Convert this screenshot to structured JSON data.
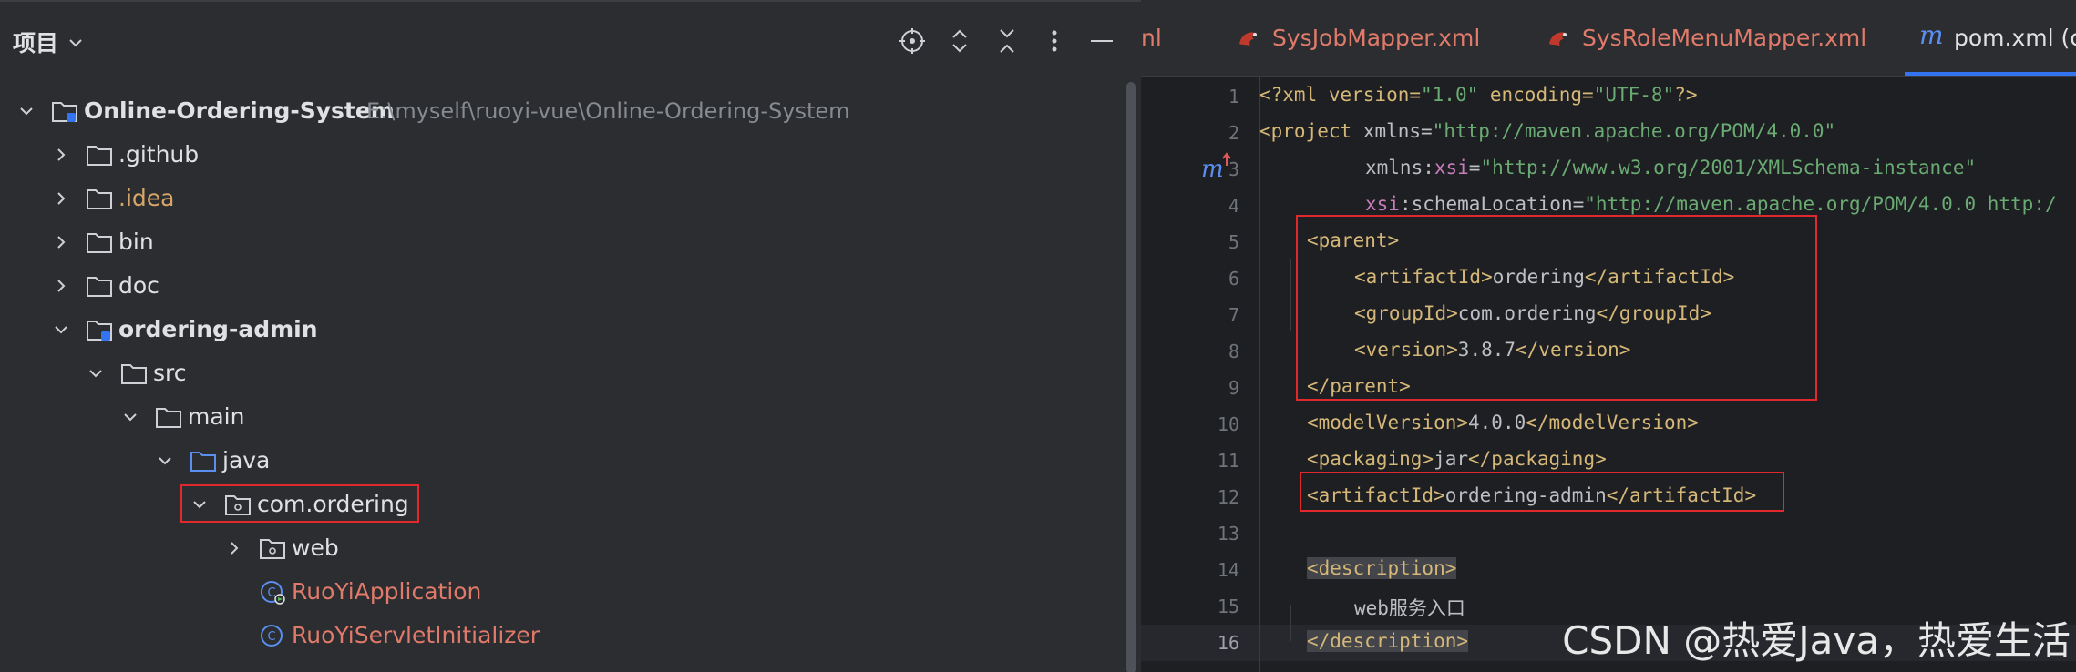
{
  "project_panel": {
    "title": "项目",
    "header_icons": [
      "locate-icon",
      "expand-all-icon",
      "collapse-all-icon",
      "more-icon",
      "minimize-icon"
    ],
    "tree": [
      {
        "label": "Online-Ordering-System",
        "path": "E:\\myself\\ruoyi-vue\\Online-Ordering-System"
      },
      {
        "label": ".github"
      },
      {
        "label": ".idea"
      },
      {
        "label": "bin"
      },
      {
        "label": "doc"
      },
      {
        "label": "ordering-admin"
      },
      {
        "label": "src"
      },
      {
        "label": "main"
      },
      {
        "label": "java"
      },
      {
        "label": "com.ordering"
      },
      {
        "label": "web"
      },
      {
        "label": "RuoYiApplication"
      },
      {
        "label": "RuoYiServletInitializer"
      }
    ]
  },
  "editor": {
    "tabs": [
      {
        "label": "nl"
      },
      {
        "label": "SysJobMapper.xml"
      },
      {
        "label": "SysRoleMenuMapper.xml"
      },
      {
        "label": "pom.xml (c"
      }
    ],
    "line_numbers": [
      "1",
      "2",
      "3",
      "4",
      "5",
      "6",
      "7",
      "8",
      "9",
      "10",
      "11",
      "12",
      "13",
      "14",
      "15",
      "16"
    ],
    "current_line": "16",
    "code": {
      "l1_a": "<?xml version=",
      "l1_b": "\"1.0\"",
      "l1_c": " encoding=",
      "l1_d": "\"UTF-8\"",
      "l1_e": "?>",
      "l2_a": "<project",
      "l2_b": " xmlns=",
      "l2_c": "\"http://maven.apache.org/POM/4.0.0\"",
      "l3_a": "xmlns:",
      "l3_b": "xsi",
      "l3_c": "=",
      "l3_d": "\"http://www.w3.org/2001/XMLSchema-instance\"",
      "l4_a": "xsi",
      "l4_b": ":schemaLocation=",
      "l4_c": "\"http://maven.apache.org/POM/4.0.0 http:/",
      "l5": "<parent>",
      "l6_a": "<artifactId>",
      "l6_b": "ordering",
      "l6_c": "</artifactId>",
      "l7_a": "<groupId>",
      "l7_b": "com.ordering",
      "l7_c": "</groupId>",
      "l8_a": "<version>",
      "l8_b": "3.8.7",
      "l8_c": "</version>",
      "l9": "</parent>",
      "l10_a": "<modelVersion>",
      "l10_b": "4.0.0",
      "l10_c": "</modelVersion>",
      "l11_a": "<packaging>",
      "l11_b": "jar",
      "l11_c": "</packaging>",
      "l12_a": "<artifactId>",
      "l12_b": "ordering-admin",
      "l12_c": "</artifactId>",
      "l14": "<description>",
      "l15": "web服务入口",
      "l16": "</description>"
    }
  },
  "watermark": "CSDN @热爱Java，热爱生活",
  "colors": {
    "highlight_box": "#e0282d",
    "tab_active": "#3574f0"
  }
}
